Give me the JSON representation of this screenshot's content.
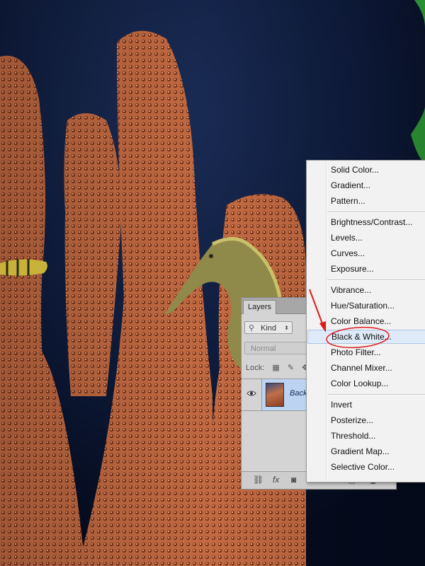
{
  "layers_panel": {
    "tab_label": "Layers",
    "kind_filter": "Kind",
    "blend_mode": "Normal",
    "lock_label": "Lock:",
    "layer_name": "Back"
  },
  "adjustment_menu": {
    "items": [
      "Solid Color...",
      "Gradient...",
      "Pattern...",
      "Brightness/Contrast...",
      "Levels...",
      "Curves...",
      "Exposure...",
      "Vibrance...",
      "Hue/Saturation...",
      "Color Balance...",
      "Black & White...",
      "Photo Filter...",
      "Channel Mixer...",
      "Color Lookup...",
      "Invert",
      "Posterize...",
      "Threshold...",
      "Gradient Map...",
      "Selective Color..."
    ],
    "highlighted": "Black & White..."
  },
  "annotation": {
    "color": "#e01a1a"
  },
  "icons": [
    "eye-icon",
    "search-icon",
    "link-icon",
    "fx-icon",
    "mask-icon",
    "adjustment-icon",
    "new-layer-icon",
    "trash-icon"
  ]
}
